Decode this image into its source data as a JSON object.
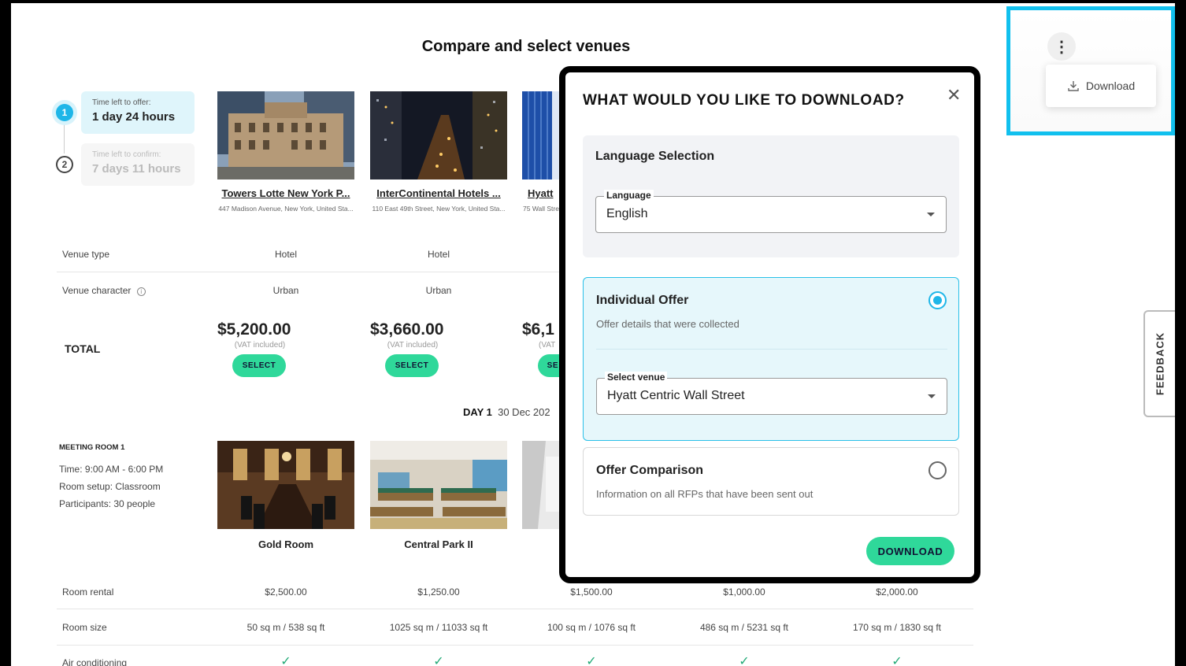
{
  "page": {
    "title": "Compare and select venues"
  },
  "timeline": [
    {
      "num": "1",
      "label": "Time left to offer:",
      "value": "1 day 24 hours"
    },
    {
      "num": "2",
      "label": "Time left to confirm:",
      "value": "7 days 11 hours"
    }
  ],
  "venues": [
    {
      "name": "Towers Lotte New York P...",
      "address": "447 Madison Avenue, New York, United Sta...",
      "type": "Hotel",
      "character": "Urban",
      "total": "$5,200.00",
      "vat": "(VAT included)",
      "select": "SELECT"
    },
    {
      "name": "InterContinental Hotels ...",
      "address": "110 East 49th Street, New York, United Sta...",
      "type": "Hotel",
      "character": "Urban",
      "total": "$3,660.00",
      "vat": "(VAT included)",
      "select": "SELECT"
    },
    {
      "name": "Hyatt",
      "address": "75 Wall Stre",
      "total": "$6,1",
      "vat": "(VAT",
      "select": "SE"
    }
  ],
  "rows": {
    "venue_type": "Venue type",
    "venue_character": "Venue character",
    "total": "TOTAL",
    "room_rental": "Room rental",
    "room_size": "Room size",
    "air_conditioning": "Air conditioning"
  },
  "day": {
    "label": "DAY 1",
    "date": "30 Dec 202"
  },
  "meeting": {
    "title": "MEETING ROOM 1",
    "time": "Time: 9:00 AM - 6:00 PM",
    "setup": "Room setup: Classroom",
    "participants": "Participants: 30 people"
  },
  "rooms": [
    {
      "name": "Gold Room",
      "rental": "$2,500.00",
      "size": "50 sq m / 538 sq ft"
    },
    {
      "name": "Central Park II",
      "rental": "$1,250.00",
      "size": "1025 sq m / 11033 sq ft"
    },
    {
      "name": "",
      "rental": "$1,500.00",
      "size": "100 sq m / 1076 sq ft"
    },
    {
      "name": "",
      "rental": "$1,000.00",
      "size": "486 sq m / 5231 sq ft"
    },
    {
      "name": "",
      "rental": "$2,000.00",
      "size": "170 sq m / 1830 sq ft"
    }
  ],
  "check_glyph": "✓",
  "menu": {
    "kebab": "⋮",
    "download": "Download"
  },
  "feedback": "FEEDBACK",
  "modal": {
    "title": "WHAT WOULD YOU LIKE TO DOWNLOAD?",
    "close": "✕",
    "language_section": "Language Selection",
    "language_label": "Language",
    "language_value": "English",
    "individual_title": "Individual Offer",
    "individual_desc": "Offer details that were collected",
    "venue_label": "Select venue",
    "venue_value": "Hyatt Centric Wall Street",
    "comparison_title": "Offer Comparison",
    "comparison_desc": "Information on all RFPs that have been sent out",
    "download_button": "DOWNLOAD",
    "selected_option": "individual"
  },
  "colors": {
    "accent": "#1fb6e8",
    "button_green": "#2fd89a",
    "highlight_border": "#11c0ee"
  }
}
